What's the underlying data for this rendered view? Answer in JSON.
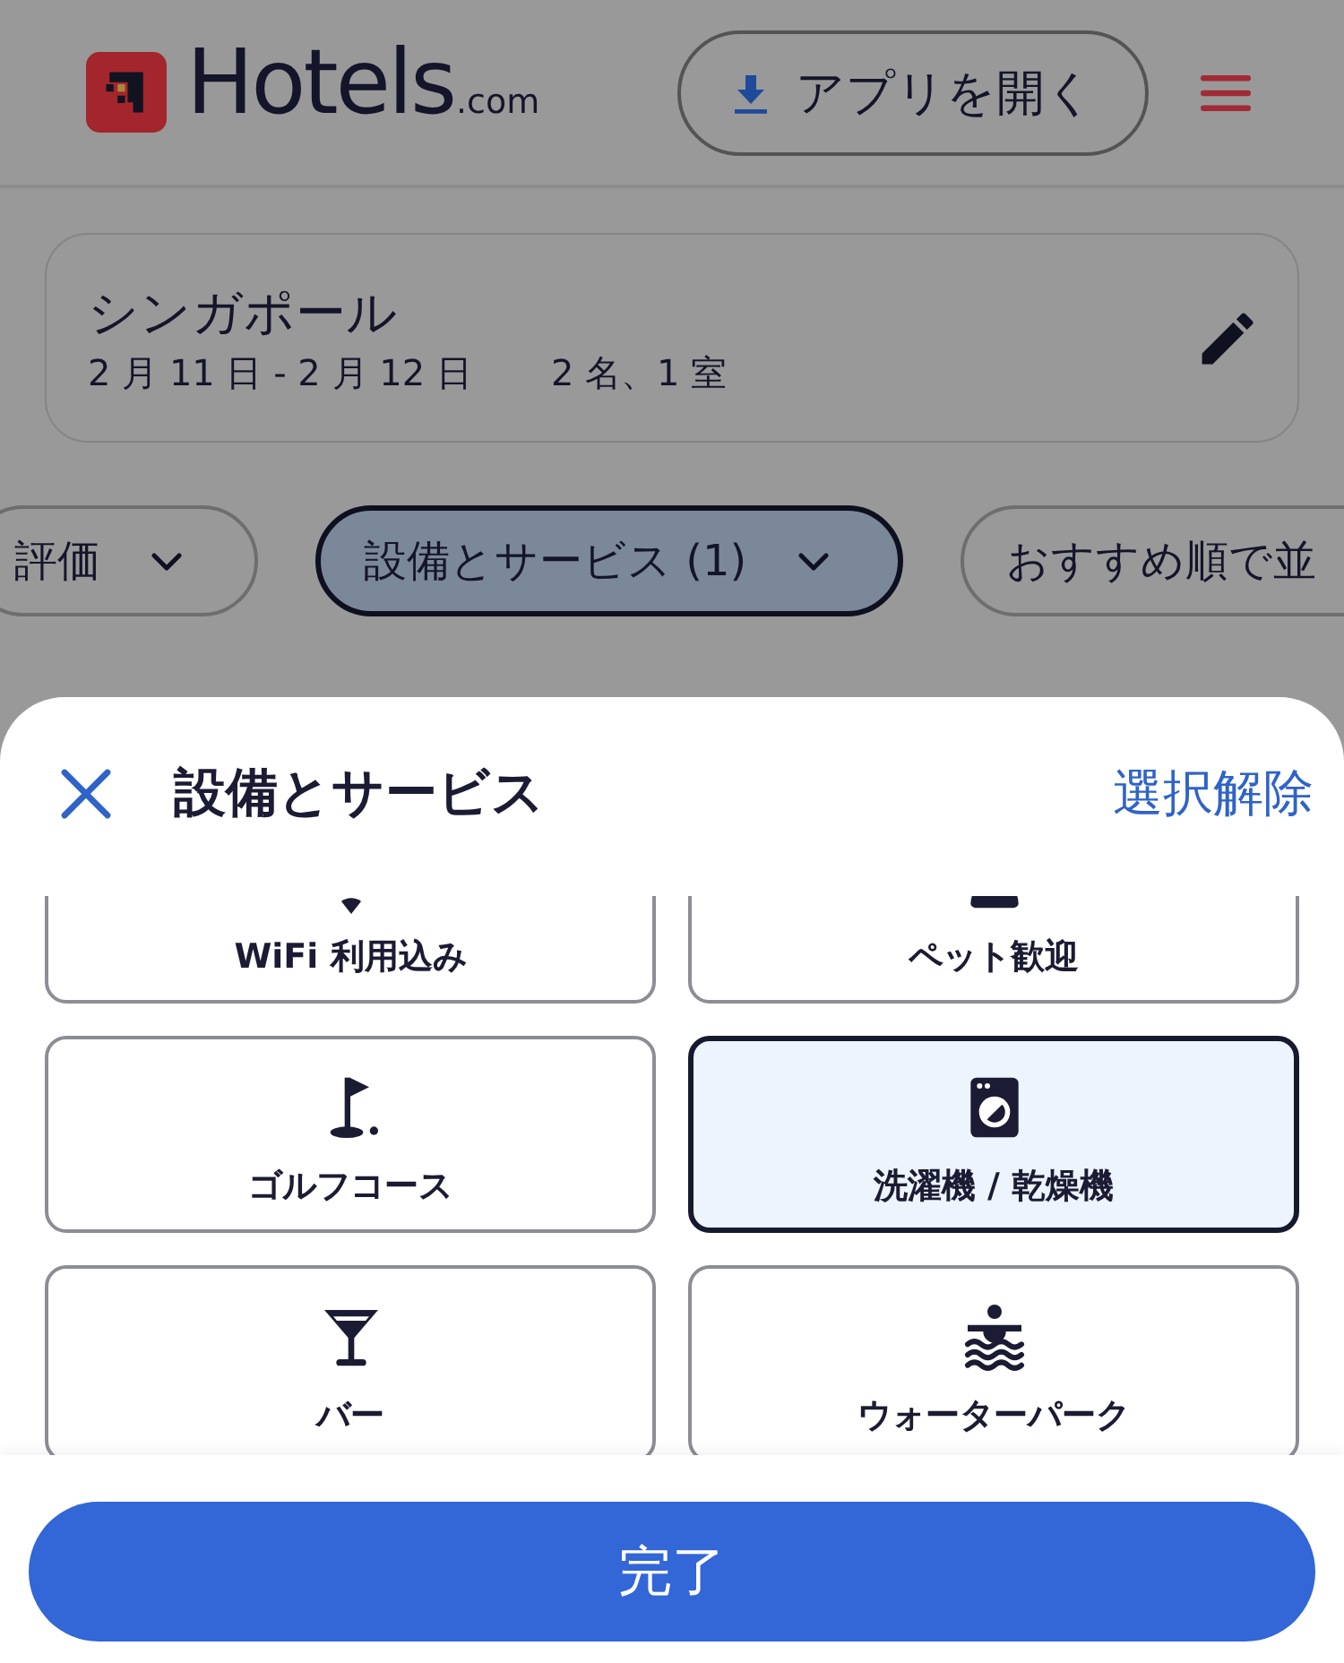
{
  "header": {
    "brand": "Hotels",
    "brand_suffix": ".com",
    "app_button": "アプリを開く"
  },
  "search_summary": {
    "destination": "シンガポール",
    "dates": "2 月 11 日 - 2 月 12 日",
    "guests": "2 名、1 室"
  },
  "filter_chips": [
    {
      "label": "評価",
      "selected": false
    },
    {
      "label": "設備とサービス (1)",
      "selected": true
    },
    {
      "label": "おすすめ順で並",
      "selected": false
    }
  ],
  "sheet": {
    "title": "設備とサービス",
    "clear_link": "選択解除",
    "amenities": [
      {
        "kind": "wifi",
        "label": "WiFi 利用込み",
        "selected": false
      },
      {
        "kind": "pets",
        "label": "ペット歓迎",
        "selected": false
      },
      {
        "kind": "golf",
        "label": "ゴルフコース",
        "selected": false
      },
      {
        "kind": "laundry",
        "label": "洗濯機 / 乾燥機",
        "selected": true
      },
      {
        "kind": "bar",
        "label": "バー",
        "selected": false
      },
      {
        "kind": "water_park",
        "label": "ウォーターパーク",
        "selected": false
      }
    ],
    "done_button": "完了"
  }
}
